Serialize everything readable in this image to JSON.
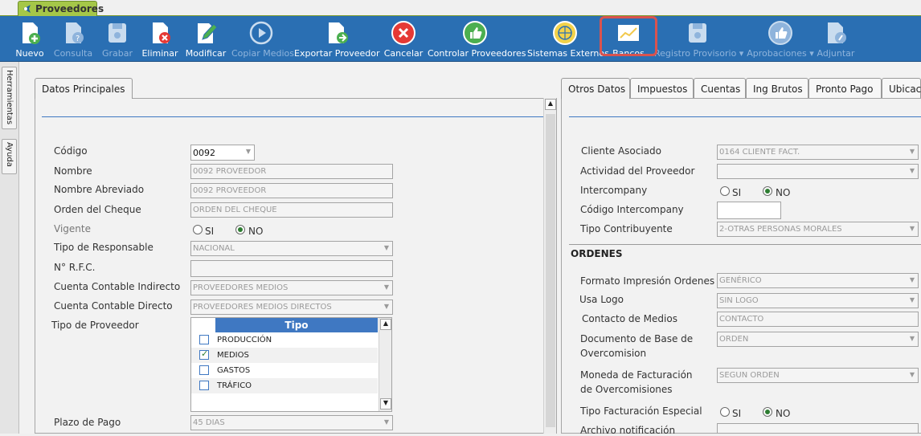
{
  "tab": {
    "title": "Proveedores"
  },
  "toolbar": {
    "buttons": [
      {
        "label": "Nuevo",
        "icon": "new-document-icon"
      },
      {
        "label": "Consulta",
        "icon": "query-document-icon"
      },
      {
        "label": "Grabar",
        "icon": "save-disk-icon"
      },
      {
        "label": "Eliminar",
        "icon": "delete-document-icon"
      },
      {
        "label": "Modificar",
        "icon": "edit-pencil-icon"
      },
      {
        "label": "Copiar Medios",
        "icon": "copy-media-icon"
      },
      {
        "label": "Exportar Proveedor",
        "icon": "export-document-icon"
      },
      {
        "label": "Cancelar",
        "icon": "cancel-icon"
      },
      {
        "label": "Controlar Proveedores",
        "icon": "thumbs-up-icon"
      },
      {
        "label": "Sistemas Externos",
        "icon": "external-systems-icon"
      },
      {
        "label": "Bancos",
        "icon": "banks-chart-icon"
      },
      {
        "label": "Registro Provisorio ▾",
        "icon": "provisional-disk-icon"
      },
      {
        "label": "Aprobaciones ▾",
        "icon": "approval-thumbs-icon"
      },
      {
        "label": "Adjuntar",
        "icon": "attach-document-icon"
      }
    ]
  },
  "side_tabs": {
    "herramientas": "Herramientas",
    "ayuda": "Ayuda"
  },
  "left_panel": {
    "tab": "Datos Principales",
    "codigo": {
      "label": "Código",
      "value": "0092"
    },
    "nombre": {
      "label": "Nombre",
      "value": "0092 PROVEEDOR"
    },
    "nombre_abreviado": {
      "label": "Nombre Abreviado",
      "value": "0092 PROVEEDOR"
    },
    "orden_cheque": {
      "label": "Orden del Cheque",
      "value": "ORDEN DEL CHEQUE"
    },
    "vigente": {
      "label": "Vigente",
      "si": "SI",
      "no": "NO",
      "selected": "NO"
    },
    "tipo_responsable": {
      "label": "Tipo de Responsable",
      "value": "NACIONAL"
    },
    "rfc": {
      "label": "N° R.F.C.",
      "value": ""
    },
    "cuenta_indirecto": {
      "label": "Cuenta Contable Indirecto",
      "value": "PROVEEDORES MEDIOS"
    },
    "cuenta_directo": {
      "label": "Cuenta Contable Directo",
      "value": "PROVEEDORES MEDIOS DIRECTOS"
    },
    "tipo_proveedor": {
      "label": "Tipo de Proveedor",
      "header": "Tipo",
      "rows": [
        {
          "label": "PRODUCCIÓN",
          "checked": false
        },
        {
          "label": "MEDIOS",
          "checked": true
        },
        {
          "label": "GASTOS",
          "checked": false
        },
        {
          "label": "TRÁFICO",
          "checked": false
        }
      ]
    },
    "plazo_pago": {
      "label": "Plazo de Pago",
      "value": "45 DIAS"
    }
  },
  "right_panel": {
    "tabs": [
      "Otros Datos",
      "Impuestos",
      "Cuentas",
      "Ing Brutos",
      "Pronto Pago",
      "Ubicac"
    ],
    "cliente_asociado": {
      "label": "Cliente Asociado",
      "value": "0164 CLIENTE FACT."
    },
    "actividad": {
      "label": "Actividad del Proveedor",
      "value": ""
    },
    "intercompany": {
      "label": "Intercompany",
      "si": "SI",
      "no": "NO",
      "selected": "NO"
    },
    "codigo_intercompany": {
      "label": "Código Intercompany",
      "value": ""
    },
    "tipo_contribuyente": {
      "label": "Tipo Contribuyente",
      "value": "2-OTRAS PERSONAS MORALES"
    },
    "ordenes_title": "ORDENES",
    "formato_impresion": {
      "label": "Formato Impresión Ordenes",
      "value": "GENÉRICO"
    },
    "usa_logo": {
      "label": "Usa Logo",
      "value": "SIN LOGO"
    },
    "contacto_medios": {
      "label": "Contacto de Medios",
      "value": "CONTACTO"
    },
    "documento_base": {
      "label1": "Documento de Base de",
      "label2": "Overcomision",
      "value": "ORDEN"
    },
    "moneda_facturacion": {
      "label1": "Moneda de Facturación",
      "label2": "de Overcomisiones",
      "value": "SEGUN ORDEN"
    },
    "tipo_facturacion": {
      "label": "Tipo Facturación Especial",
      "si": "SI",
      "no": "NO",
      "selected": "NO"
    },
    "archivo_notificacion": {
      "label": "Archivo notificación"
    }
  },
  "colors": {
    "toolbar": "#2a6fb3",
    "tab_green": "#a5c748",
    "accent": "#3f78c2",
    "highlight": "#d9534f"
  }
}
